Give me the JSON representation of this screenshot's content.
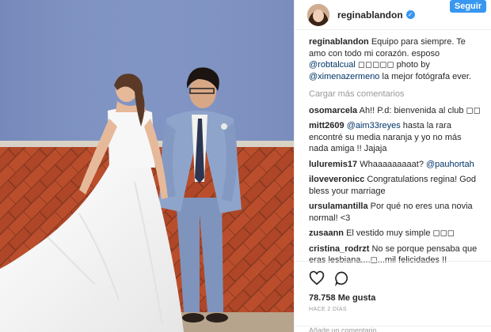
{
  "post": {
    "username": "reginablandon",
    "verified_icon": "verified-badge-icon",
    "follow_label": "Seguir"
  },
  "caption": {
    "user": "reginablandon",
    "text_1": "Equipo para siempre. Te amo con todo mi corazón. esposo ",
    "mention_1": "@robtalcual",
    "text_2": " ◻◻◻◻◻ photo by ",
    "mention_2": "@ximenazermeno",
    "text_3": " la mejor fotógrafa ever."
  },
  "load_more_label": "Cargar más comentarios",
  "comments": [
    {
      "user": "osomarcela",
      "parts": [
        {
          "t": "Ah!! P.d: bienvenida al club ◻◻"
        }
      ]
    },
    {
      "user": "mitt2609",
      "parts": [
        {
          "m": "@aim33reyes"
        },
        {
          "t": " hasta la rara encontré su media naranja y yo no más nada amiga !! Jajaja"
        }
      ]
    },
    {
      "user": "luluremis17",
      "parts": [
        {
          "t": "Whaaaaaaaaat? "
        },
        {
          "m": "@pauhortah"
        }
      ]
    },
    {
      "user": "iloveveronicc",
      "parts": [
        {
          "t": "Congratulations regina! God bless your marriage"
        }
      ]
    },
    {
      "user": "ursulamantilla",
      "parts": [
        {
          "t": "Por qué no eres una novia normal! <3"
        }
      ]
    },
    {
      "user": "zusaann",
      "parts": [
        {
          "t": "El vestido muy simple ◻◻◻"
        }
      ]
    },
    {
      "user": "cristina_rodrzt",
      "parts": [
        {
          "t": "No se porque pensaba que eras lesbiana....◻...mil felicidades !!"
        }
      ]
    }
  ],
  "actions": {
    "like_icon": "heart-icon",
    "comment_icon": "comment-bubble-icon"
  },
  "likes_label": "78.758 Me gusta",
  "time_label": "HACE 2 DÍAS",
  "add_comment_placeholder": "Añade un comentario..."
}
